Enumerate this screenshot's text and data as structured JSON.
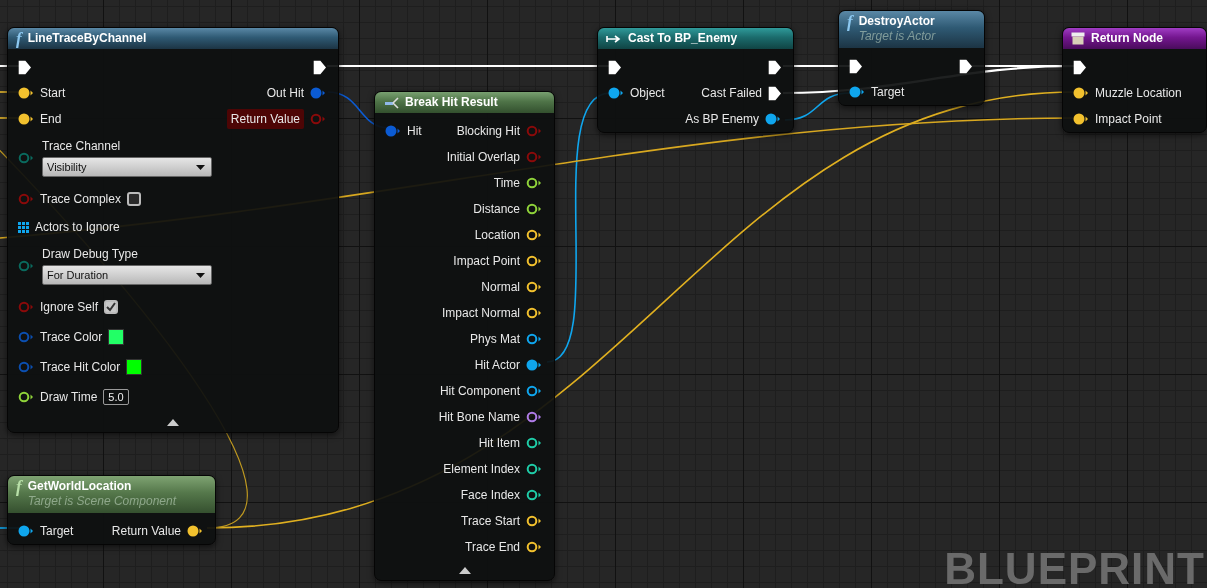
{
  "watermark": "BLUEPRINT",
  "nodes": [
    {
      "kind": "function",
      "glyph": "f",
      "title": "LineTraceByChannel",
      "advanced_expanded": true,
      "rows": [
        {
          "left": {
            "kind": "exec",
            "connected": true
          },
          "right": {
            "kind": "exec",
            "connected": true
          }
        },
        {
          "left": {
            "kind": "vector",
            "label": "Start",
            "connected": true
          },
          "right": {
            "kind": "struct",
            "label": "Out Hit",
            "connected": true
          }
        },
        {
          "left": {
            "kind": "vector",
            "label": "End",
            "connected": true
          },
          "right": {
            "kind": "bool",
            "label": "Return Value",
            "connected": false,
            "highlighted": true
          }
        },
        {
          "left": {
            "kind": "enum",
            "label": "Trace Channel",
            "connected": false,
            "widget": {
              "kind": "dropdown",
              "value": "Visibility"
            }
          }
        },
        {
          "left": {
            "kind": "bool",
            "label": "Trace Complex",
            "connected": false,
            "widget": {
              "kind": "checkbox",
              "checked": false
            }
          }
        },
        {
          "left": {
            "kind": "array",
            "label": "Actors to Ignore",
            "connected": false
          }
        },
        {
          "left": {
            "kind": "enum",
            "label": "Draw Debug Type",
            "connected": false,
            "widget": {
              "kind": "dropdown",
              "value": "For Duration"
            }
          }
        },
        {
          "left": {
            "kind": "bool",
            "label": "Ignore Self",
            "connected": false,
            "widget": {
              "kind": "checkbox",
              "checked": true
            }
          }
        },
        {
          "left": {
            "kind": "color",
            "label": "Trace Color",
            "connected": false,
            "widget": {
              "kind": "swatch",
              "color": "#22ff66"
            }
          }
        },
        {
          "left": {
            "kind": "color",
            "label": "Trace Hit Color",
            "connected": false,
            "widget": {
              "kind": "swatch",
              "color": "#00ff00"
            }
          }
        },
        {
          "left": {
            "kind": "float",
            "label": "Draw Time",
            "connected": false,
            "widget": {
              "kind": "number",
              "value": "5.0"
            }
          }
        }
      ]
    },
    {
      "kind": "break",
      "title": "Break Hit Result",
      "advanced_expanded": true,
      "rows": [
        {
          "left": {
            "kind": "struct",
            "label": "Hit",
            "connected": true
          },
          "right": {
            "kind": "bool",
            "label": "Blocking Hit",
            "connected": false
          }
        },
        {
          "right": {
            "kind": "bool",
            "label": "Initial Overlap",
            "connected": false
          }
        },
        {
          "right": {
            "kind": "float",
            "label": "Time",
            "connected": false
          }
        },
        {
          "right": {
            "kind": "float",
            "label": "Distance",
            "connected": false
          }
        },
        {
          "right": {
            "kind": "vector",
            "label": "Location",
            "connected": false
          }
        },
        {
          "right": {
            "kind": "vector",
            "label": "Impact Point",
            "connected": false
          }
        },
        {
          "right": {
            "kind": "vector",
            "label": "Normal",
            "connected": false
          }
        },
        {
          "right": {
            "kind": "vector",
            "label": "Impact Normal",
            "connected": false
          }
        },
        {
          "right": {
            "kind": "object",
            "label": "Phys Mat",
            "connected": false
          }
        },
        {
          "right": {
            "kind": "object",
            "label": "Hit Actor",
            "connected": true
          }
        },
        {
          "right": {
            "kind": "object",
            "label": "Hit Component",
            "connected": false
          }
        },
        {
          "right": {
            "kind": "name",
            "label": "Hit Bone Name",
            "connected": false
          }
        },
        {
          "right": {
            "kind": "int",
            "label": "Hit Item",
            "connected": false
          }
        },
        {
          "right": {
            "kind": "int",
            "label": "Element Index",
            "connected": false
          }
        },
        {
          "right": {
            "kind": "int",
            "label": "Face Index",
            "connected": false
          }
        },
        {
          "right": {
            "kind": "vector",
            "label": "Trace Start",
            "connected": false
          }
        },
        {
          "right": {
            "kind": "vector",
            "label": "Trace End",
            "connected": false
          }
        }
      ]
    },
    {
      "kind": "cast",
      "title": "Cast To BP_Enemy",
      "rows": [
        {
          "left": {
            "kind": "exec",
            "connected": true
          },
          "right": {
            "kind": "exec",
            "connected": true
          }
        },
        {
          "left": {
            "kind": "object",
            "label": "Object",
            "connected": true
          },
          "right": {
            "kind": "exec",
            "label": "Cast Failed",
            "connected": true
          }
        },
        {
          "right": {
            "kind": "object",
            "label": "As BP Enemy",
            "connected": true
          }
        }
      ]
    },
    {
      "kind": "function",
      "glyph": "f",
      "title": "DestroyActor",
      "subtitle": "Target is Actor",
      "rows": [
        {
          "left": {
            "kind": "exec",
            "connected": true
          },
          "right": {
            "kind": "exec",
            "connected": true
          }
        },
        {
          "left": {
            "kind": "object",
            "label": "Target",
            "connected": true
          }
        }
      ]
    },
    {
      "kind": "return",
      "title": "Return Node",
      "rows": [
        {
          "left": {
            "kind": "exec",
            "connected": true
          }
        },
        {
          "left": {
            "kind": "vector",
            "label": "Muzzle Location",
            "connected": true
          }
        },
        {
          "left": {
            "kind": "vector",
            "label": "Impact Point",
            "connected": true
          }
        }
      ]
    },
    {
      "kind": "pure",
      "glyph": "f",
      "title": "GetWorldLocation",
      "subtitle": "Target is Scene Component",
      "rows": [
        {
          "left": {
            "kind": "object",
            "label": "Target",
            "connected": true
          },
          "right": {
            "kind": "vector",
            "label": "Return Value",
            "connected": true
          }
        }
      ]
    }
  ]
}
